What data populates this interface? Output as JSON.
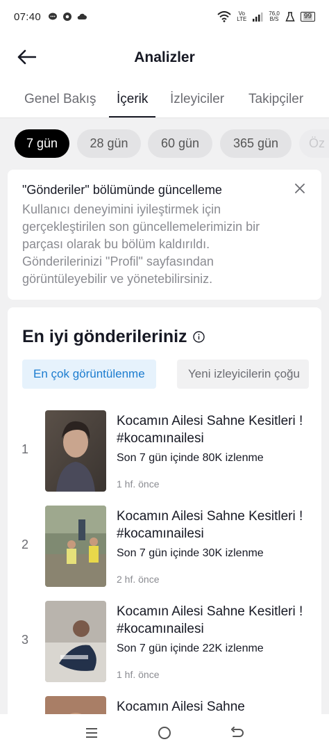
{
  "status": {
    "time": "07:40",
    "network_top": "Vo",
    "network_bottom": "LTE",
    "speed_top": "76,0",
    "speed_bottom": "B/S",
    "battery": "99"
  },
  "header": {
    "title": "Analizler"
  },
  "tabs": [
    {
      "label": "Genel Bakış"
    },
    {
      "label": "İçerik"
    },
    {
      "label": "İzleyiciler"
    },
    {
      "label": "Takipçiler"
    }
  ],
  "date_chips": [
    {
      "label": "7 gün"
    },
    {
      "label": "28 gün"
    },
    {
      "label": "60 gün"
    },
    {
      "label": "365 gün"
    },
    {
      "label": "Öz"
    }
  ],
  "notice": {
    "title": "\"Gönderiler\" bölümünde güncelleme",
    "body": "Kullanıcı deneyimini iyileştirmek için gerçekleştirilen son güncellemelerimizin bir parçası olarak bu bölüm kaldırıldı. Gönderilerinizi \"Profil\" sayfasından görüntüleyebilir ve yönetebilirsiniz."
  },
  "top_posts": {
    "title": "En iyi gönderileriniz",
    "filters": [
      {
        "label": "En çok görüntülenme"
      },
      {
        "label": "Yeni izleyicilerin çoğu"
      }
    ],
    "items": [
      {
        "rank": "1",
        "title": "Kocamın Ailesi Sahne Kesitleri ! #kocamınailesi",
        "views": "Son 7 gün içinde 80K izlenme",
        "ago": "1 hf. önce"
      },
      {
        "rank": "2",
        "title": "Kocamın Ailesi Sahne Kesitleri ! #kocamınailesi",
        "views": "Son 7 gün içinde 30K izlenme",
        "ago": "2 hf. önce"
      },
      {
        "rank": "3",
        "title": "Kocamın Ailesi Sahne Kesitleri ! #kocamınailesi",
        "views": "Son 7 gün içinde 22K izlenme",
        "ago": "1 hf. önce"
      },
      {
        "rank": "",
        "title": "Kocamın Ailesi Sahne",
        "views": "",
        "ago": ""
      }
    ]
  }
}
